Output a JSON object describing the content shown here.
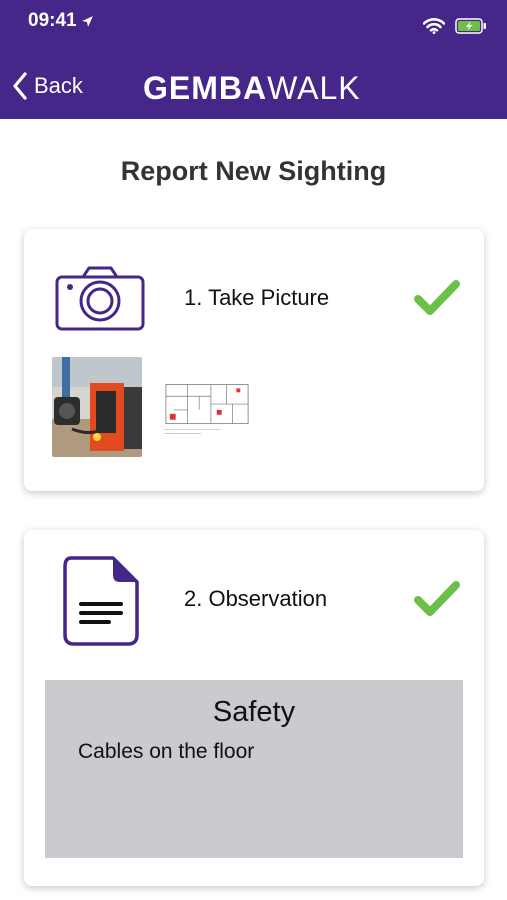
{
  "status_bar": {
    "time": "09:41"
  },
  "nav": {
    "back_label": "Back",
    "logo_bold": "GEMBA",
    "logo_light": "WALK"
  },
  "page_title": "Report New Sighting",
  "steps": [
    {
      "label": "1. Take Picture",
      "completed": true,
      "icon": "camera-icon"
    },
    {
      "label": "2. Observation",
      "completed": true,
      "icon": "document-icon"
    }
  ],
  "observation": {
    "category": "Safety",
    "text": "Cables on the floor"
  },
  "colors": {
    "brand": "#45278a",
    "check": "#6cc04a",
    "observation_bg": "#cacacf"
  }
}
